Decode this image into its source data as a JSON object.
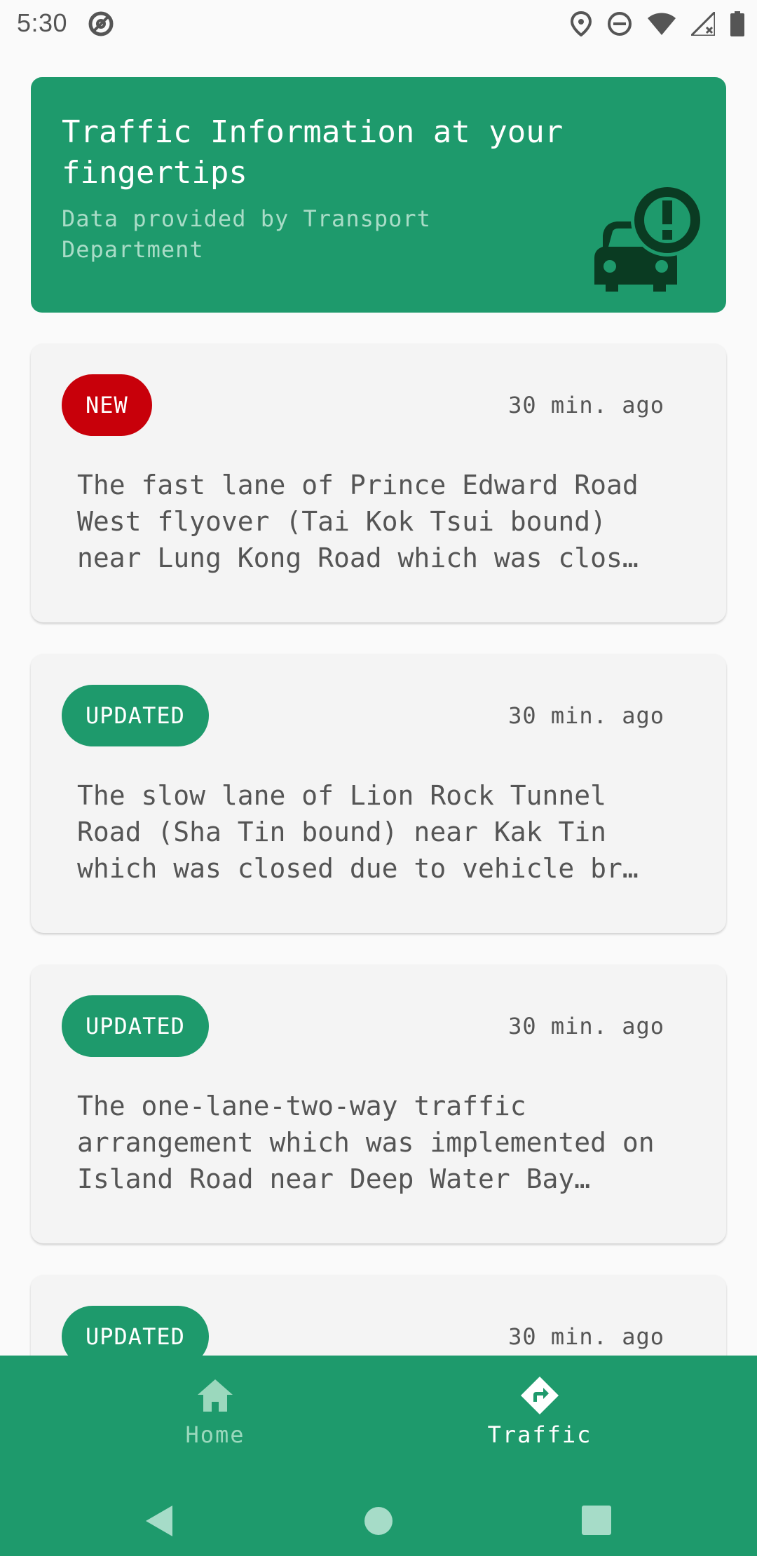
{
  "status_bar": {
    "time": "5:30"
  },
  "banner": {
    "title": "Traffic Information at your fingertips",
    "subtitle": "Data provided by Transport Department",
    "icon": "car-alert-icon",
    "background": "#1e9a6c"
  },
  "cards": [
    {
      "badge": "NEW",
      "badge_color": "#c8000a",
      "time": "30 min. ago",
      "text": "The fast lane of Prince Edward Road West flyover (Tai Kok Tsui bound) near Lung Kong Road which was clos…"
    },
    {
      "badge": "UPDATED",
      "badge_color": "#1e9a6c",
      "time": "30 min. ago",
      "text": "The slow lane of Lion Rock Tunnel Road (Sha Tin bound) near Kak Tin which was closed due to vehicle br…"
    },
    {
      "badge": "UPDATED",
      "badge_color": "#1e9a6c",
      "time": "30 min. ago",
      "text": "The one-lane-two-way traffic arrangement which was implemented on Island Road near Deep Water Bay…"
    },
    {
      "badge": "UPDATED",
      "badge_color": "#1e9a6c",
      "time": "30 min. ago",
      "text": ""
    }
  ],
  "bottom_nav": {
    "items": [
      {
        "label": "Home",
        "icon": "home-icon",
        "active": false
      },
      {
        "label": "Traffic",
        "icon": "directions-icon",
        "active": true
      }
    ]
  },
  "colors": {
    "accent": "#1e9a6c",
    "alert": "#c8000a"
  }
}
